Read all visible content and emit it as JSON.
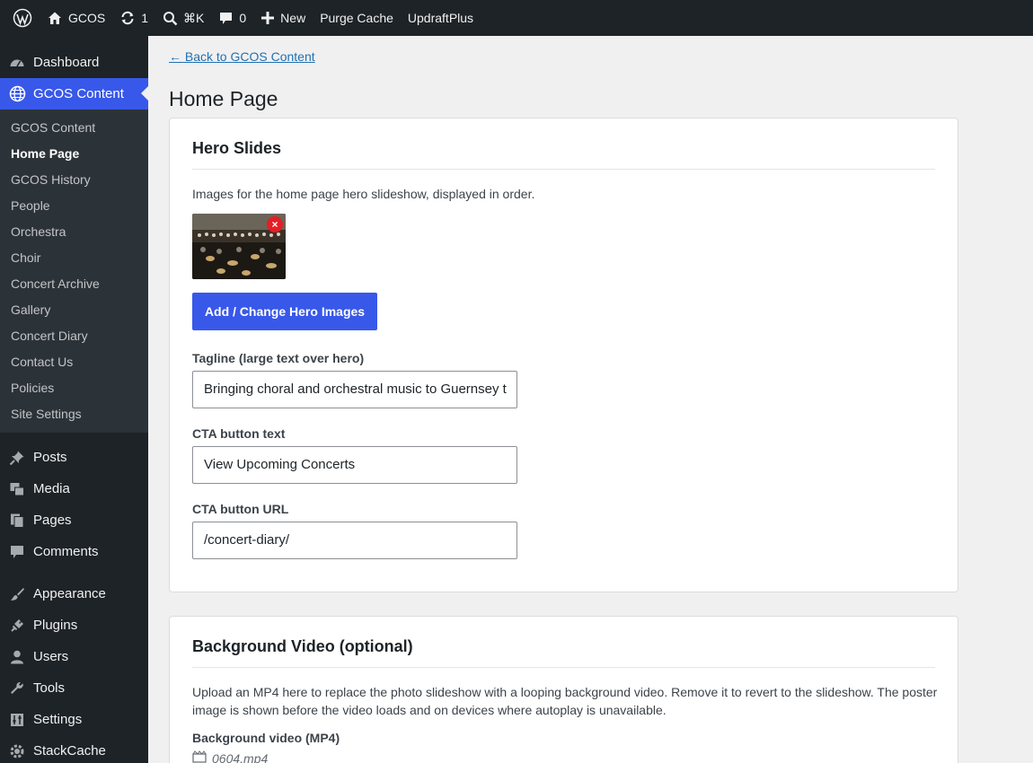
{
  "adminbar": {
    "site_name": "GCOS",
    "updates_count": "1",
    "search_shortcut": "⌘K",
    "comments_count": "0",
    "new_label": "New",
    "purge_cache_label": "Purge Cache",
    "updraft_label": "UpdraftPlus"
  },
  "sidebar": {
    "dashboard": "Dashboard",
    "gcos_content": "GCOS Content",
    "submenu": [
      "GCOS Content",
      "Home Page",
      "GCOS History",
      "People",
      "Orchestra",
      "Choir",
      "Concert Archive",
      "Gallery",
      "Concert Diary",
      "Contact Us",
      "Policies",
      "Site Settings"
    ],
    "posts": "Posts",
    "media": "Media",
    "pages": "Pages",
    "comments": "Comments",
    "appearance": "Appearance",
    "plugins": "Plugins",
    "users": "Users",
    "tools": "Tools",
    "settings": "Settings",
    "stackcache": "StackCache"
  },
  "main": {
    "back_link": "← Back to GCOS Content",
    "title": "Home Page",
    "hero": {
      "heading": "Hero Slides",
      "description": "Images for the home page hero slideshow, displayed in order.",
      "remove_glyph": "×",
      "add_button": "Add / Change Hero Images",
      "tagline_label": "Tagline (large text over hero)",
      "tagline_value": "Bringing choral and orchestral music to Guernsey t",
      "cta_text_label": "CTA button text",
      "cta_text_value": "View Upcoming Concerts",
      "cta_url_label": "CTA button URL",
      "cta_url_value": "/concert-diary/"
    },
    "video": {
      "heading": "Background Video (optional)",
      "description": "Upload an MP4 here to replace the photo slideshow with a looping background video. Remove it to revert to the slideshow. The poster image is shown before the video loads and on devices where autoplay is unavailable.",
      "field_label": "Background video (MP4)",
      "file_name": "0604.mp4"
    }
  },
  "colors": {
    "accent": "#3858e9",
    "adminbar_bg": "#1d2327",
    "remove_red": "#e41e26"
  }
}
